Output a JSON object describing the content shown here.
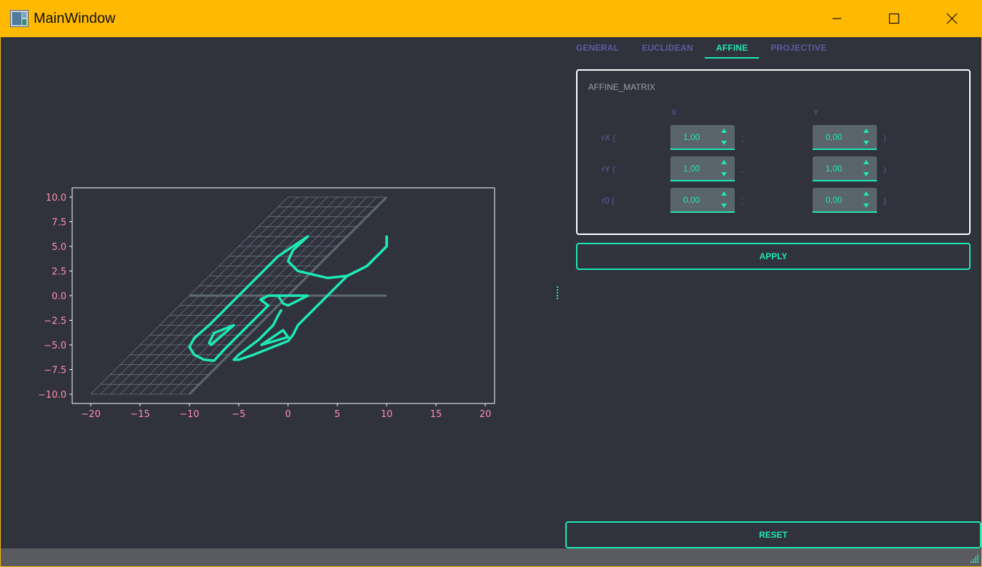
{
  "window": {
    "title": "MainWindow"
  },
  "tabs": [
    {
      "label": "GENERAL"
    },
    {
      "label": "EUCLIDEAN"
    },
    {
      "label": "AFFINE"
    },
    {
      "label": "PROJECTIVE"
    }
  ],
  "active_tab": "AFFINE",
  "matrix": {
    "title": "AFFINE_MATRIX",
    "col_x": "X",
    "col_y": "Y",
    "separator": ";",
    "close_paren": ")",
    "rows": [
      {
        "label": "rX (",
        "x": "1,00",
        "y": "0,00"
      },
      {
        "label": "rY (",
        "x": "1,00",
        "y": "1,00"
      },
      {
        "label": "r0 (",
        "x": "0,00",
        "y": "0,00"
      }
    ]
  },
  "buttons": {
    "apply": "APPLY",
    "reset": "RESET"
  },
  "colors": {
    "accent": "#1de9b6",
    "background": "#30323c",
    "titlebar": "#ffb900",
    "tab_inactive": "#5b5da0",
    "tick_label": "#ff8fb3",
    "grid": "#6d7480"
  },
  "chart_data": {
    "type": "line",
    "xlim": [
      -20,
      20
    ],
    "ylim": [
      -10,
      10
    ],
    "xticks": [
      "−20",
      "−15",
      "−10",
      "−5",
      "0",
      "5",
      "10",
      "15",
      "20"
    ],
    "yticks": [
      "10.0",
      "7.5",
      "5.0",
      "2.5",
      "0.0",
      "−2.5",
      "−5.0",
      "−7.5",
      "−10.0"
    ],
    "grid": "sheared lattice: x_plot = x + y, for x in [-10, 0] and y in [-10, 10], step 1",
    "axes_lines": [
      {
        "name": "x-axis",
        "points": [
          [
            -10,
            0
          ],
          [
            10,
            0
          ]
        ]
      },
      {
        "name": "y-axis",
        "points": [
          [
            -10,
            -10
          ],
          [
            10,
            10
          ]
        ]
      }
    ],
    "series": [
      {
        "points": [
          [
            2,
            6
          ],
          [
            -1,
            4
          ],
          [
            -3,
            2
          ],
          [
            -4,
            1
          ],
          [
            -5,
            0
          ],
          [
            -6,
            -1
          ],
          [
            -7,
            -2
          ],
          [
            -8,
            -3
          ],
          [
            -9.5,
            -4.3
          ],
          [
            -10,
            -5.2
          ],
          [
            -9.5,
            -6
          ],
          [
            -8.5,
            -6.5
          ],
          [
            -7.5,
            -6.6
          ],
          [
            -6.5,
            -5.5
          ],
          [
            -4,
            -3
          ],
          [
            -3,
            -2
          ],
          [
            -2,
            -1
          ],
          [
            -2.8,
            -0.4
          ],
          [
            -2,
            0
          ],
          [
            -1,
            0
          ],
          [
            -0.5,
            -0.8
          ],
          [
            0,
            -1
          ],
          [
            1,
            -0.5
          ],
          [
            2,
            0
          ],
          [
            0.5,
            0
          ],
          [
            -1,
            0
          ]
        ]
      },
      {
        "points": [
          [
            10,
            6
          ],
          [
            10,
            5
          ],
          [
            8,
            3
          ],
          [
            6,
            2
          ],
          [
            4,
            1.8
          ],
          [
            1,
            2.5
          ],
          [
            0,
            3.5
          ],
          [
            0.5,
            4.6
          ],
          [
            2,
            6
          ]
        ]
      },
      {
        "points": [
          [
            10,
            6
          ],
          [
            10,
            5
          ],
          [
            8,
            3
          ],
          [
            6,
            2
          ],
          [
            5,
            1
          ],
          [
            4,
            0
          ],
          [
            2,
            -2
          ],
          [
            1,
            -3
          ],
          [
            0.5,
            -4
          ],
          [
            0,
            -4.6
          ],
          [
            -3.5,
            -6
          ],
          [
            -5,
            -6.5
          ],
          [
            -5.5,
            -6.5
          ],
          [
            -5,
            -6
          ],
          [
            -3,
            -4.5
          ],
          [
            -1.5,
            -3
          ],
          [
            -1,
            -2
          ],
          [
            -0.7,
            -1.5
          ]
        ]
      },
      {
        "points": [
          [
            -7.5,
            -3.8
          ],
          [
            -8,
            -4.8
          ],
          [
            -7.8,
            -5
          ],
          [
            -5.5,
            -3
          ],
          [
            -7.5,
            -3.8
          ]
        ]
      },
      {
        "points": [
          [
            -0.5,
            -3.5
          ],
          [
            0,
            -4.2
          ],
          [
            -2.7,
            -5
          ],
          [
            -0.5,
            -3.5
          ]
        ]
      }
    ]
  }
}
